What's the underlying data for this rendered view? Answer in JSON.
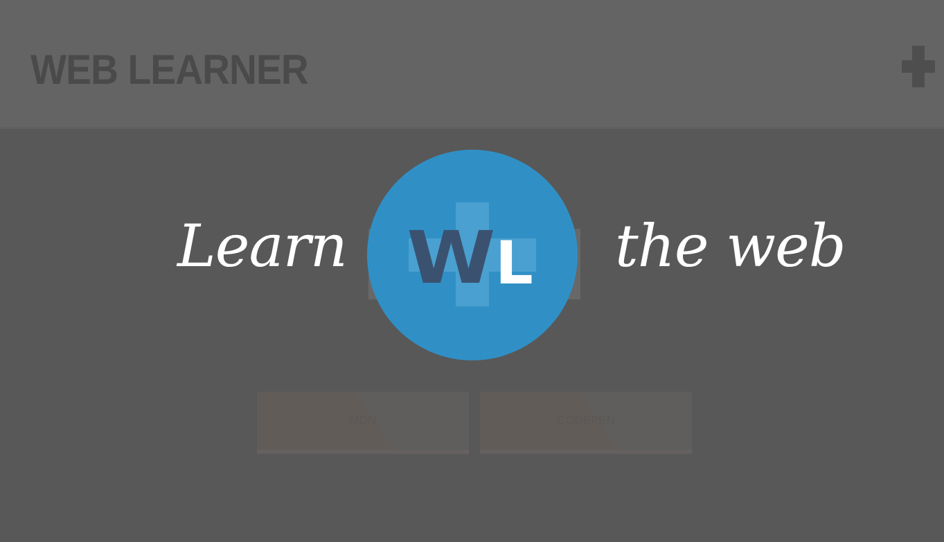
{
  "header": {
    "title": "WEB LEARNER",
    "add_icon": "plus-icon"
  },
  "tiles": [
    {
      "label": "MDN"
    },
    {
      "label": "CODEPEN"
    }
  ],
  "splash": {
    "tagline_left": "Learn",
    "tagline_right": "the web",
    "logo_letter_1": "W",
    "logo_letter_2": "L",
    "logo_color": "#3090c6",
    "logo_w_color": "#3a5270"
  }
}
